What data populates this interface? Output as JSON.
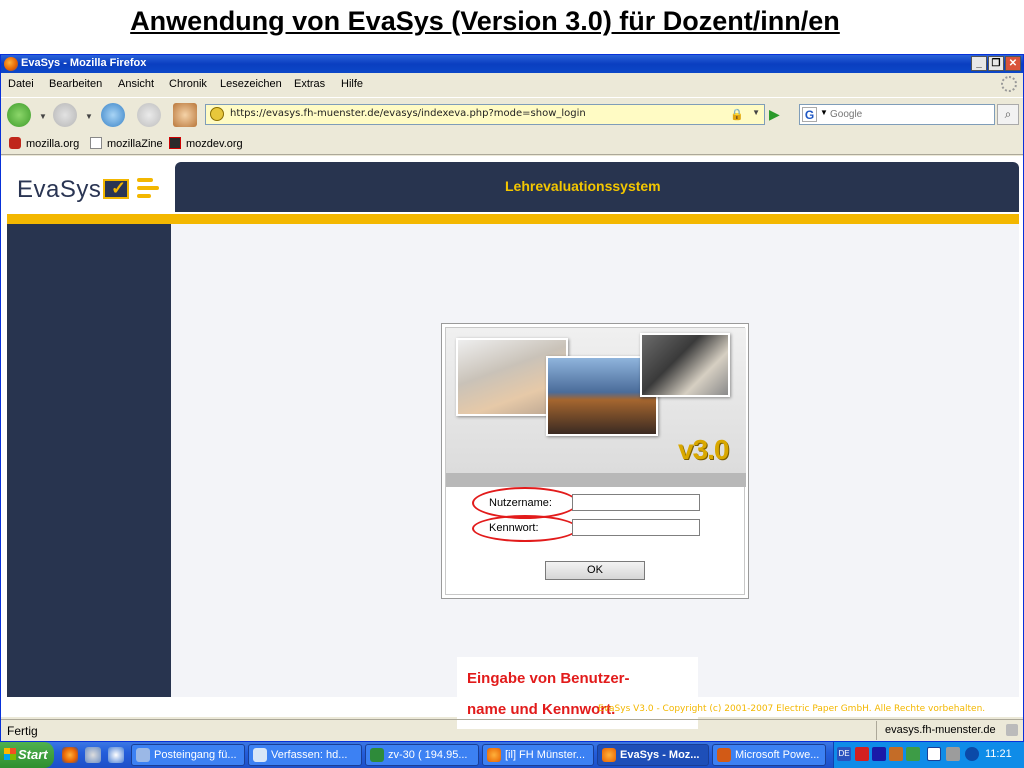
{
  "slide": {
    "title": "Anwendung von EvaSys (Version 3.0) für Dozent/inn/en"
  },
  "window": {
    "title": "EvaSys - Mozilla Firefox",
    "minimize": "_",
    "maximize": "❐",
    "close": "✕"
  },
  "menubar": [
    "Datei",
    "Bearbeiten",
    "Ansicht",
    "Chronik",
    "Lesezeichen",
    "Extras",
    "Hilfe"
  ],
  "navbar": {
    "url": "https://evasys.fh-muenster.de/evasys/indexeva.php?mode=show_login",
    "search_placeholder": "Google",
    "search_engine_letter": "G"
  },
  "bookmarks": [
    "mozilla.org",
    "mozillaZine",
    "mozdev.org"
  ],
  "evasys": {
    "logo": "EvaSys",
    "header_title": "Lehrevaluationssystem",
    "version_badge": "v3.0",
    "username_label": "Nutzername:",
    "password_label": "Kennwort:",
    "ok_label": "OK",
    "copyright": "EvaSys V3.0 - Copyright (c) 2001-2007 Electric Paper GmbH. Alle Rechte vorbehalten."
  },
  "callout": {
    "line1": "Eingabe von Benutzer-",
    "line2": "name und Kennwort."
  },
  "status": {
    "text": "Fertig",
    "host": "evasys.fh-muenster.de"
  },
  "taskbar": {
    "start": "Start",
    "tasks": [
      "Posteingang fü...",
      "Verfassen: hd...",
      "zv-30 ( 194.95...",
      "[il] FH Münster...",
      "EvaSys - Moz...",
      "Microsoft Powe..."
    ],
    "tray_lang": "DE",
    "clock": "11:21"
  },
  "colors": {
    "navy": "#28344f",
    "accent_yellow": "#f3b700",
    "highlight_red": "#e21b1b",
    "xp_blue": "#245edb"
  }
}
